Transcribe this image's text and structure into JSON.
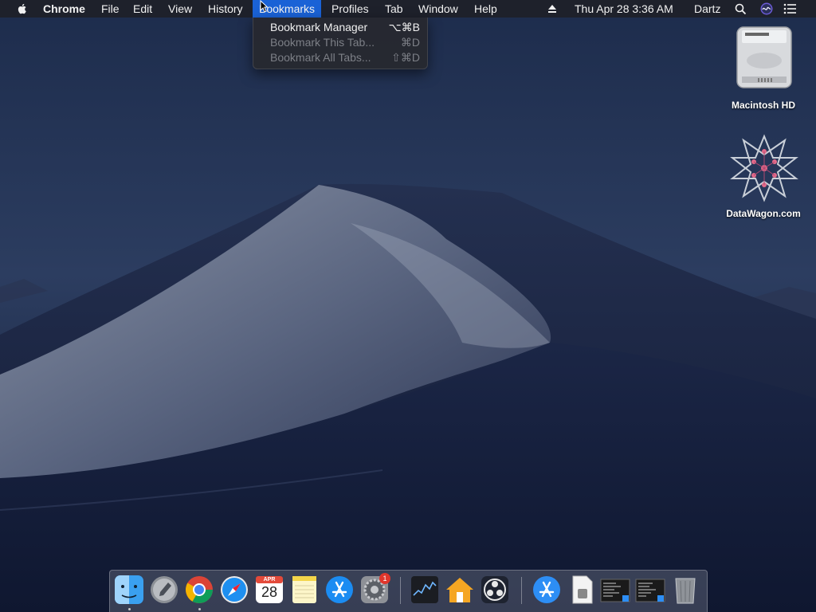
{
  "menubar": {
    "app_name": "Chrome",
    "menus": [
      "File",
      "Edit",
      "View",
      "History",
      "Bookmarks",
      "Profiles",
      "Tab",
      "Window",
      "Help"
    ],
    "active_menu": "Bookmarks",
    "clock": "Thu Apr 28  3:36 AM",
    "user": "Dartz"
  },
  "bookmarks_menu": {
    "items": [
      {
        "label": "Bookmark Manager",
        "shortcut": "⌥⌘B",
        "enabled": true
      },
      {
        "label": "Bookmark This Tab...",
        "shortcut": "⌘D",
        "enabled": false
      },
      {
        "label": "Bookmark All Tabs...",
        "shortcut": "⇧⌘D",
        "enabled": false
      }
    ]
  },
  "desktop": {
    "icons": [
      {
        "label": "Macintosh HD",
        "icon": "hard-drive-icon"
      },
      {
        "label": "DataWagon.com",
        "icon": "datawagon-logo-icon"
      }
    ]
  },
  "dock": {
    "apps": [
      {
        "name": "finder",
        "icon": "finder-icon",
        "running": true
      },
      {
        "name": "launchpad",
        "icon": "launchpad-icon",
        "running": false
      },
      {
        "name": "chrome",
        "icon": "chrome-icon",
        "running": true
      },
      {
        "name": "safari",
        "icon": "safari-icon",
        "running": false
      },
      {
        "name": "calendar",
        "icon": "calendar-icon",
        "running": false,
        "month": "APR",
        "day": "28"
      },
      {
        "name": "notes",
        "icon": "notes-icon",
        "running": false
      },
      {
        "name": "app-store",
        "icon": "app-store-icon",
        "running": false
      },
      {
        "name": "system-preferences",
        "icon": "gear-icon",
        "running": false,
        "badge": "1"
      },
      {
        "name": "stocks",
        "icon": "stocks-icon",
        "running": false
      },
      {
        "name": "home",
        "icon": "home-icon",
        "running": false
      },
      {
        "name": "obs",
        "icon": "obs-icon",
        "running": false
      },
      {
        "name": "applications-folder",
        "icon": "app-store-icon",
        "running": false
      },
      {
        "name": "documents",
        "icon": "document-icon",
        "running": false
      },
      {
        "name": "terminal-1",
        "icon": "terminal-window-icon",
        "running": false
      },
      {
        "name": "terminal-2",
        "icon": "terminal-window-icon",
        "running": false
      },
      {
        "name": "trash",
        "icon": "trash-icon",
        "running": false
      }
    ]
  },
  "colors": {
    "menu_highlight": "#1a62d6",
    "sky_top": "#1d2c4c",
    "sky_bottom": "#0e1530",
    "dune_light": "#8a93a6"
  }
}
